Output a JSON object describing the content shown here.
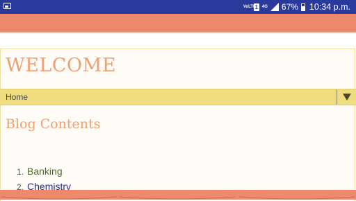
{
  "status_bar": {
    "volte": "VoLTE",
    "sim": "1",
    "network": "4G",
    "battery_percent": "67%",
    "battery_level": 0.67,
    "time": "10:34 p.m."
  },
  "page": {
    "welcome": "WELCOME",
    "nav": {
      "selected": "Home"
    },
    "blog_title": "Blog Contents",
    "list": [
      {
        "number": "1.",
        "label": "Banking"
      },
      {
        "number": "2.",
        "label": "Chemistry"
      }
    ]
  },
  "colors": {
    "status_bar": "#2a3a9c",
    "header": "#ec8a6b",
    "nav_bar": "#efdc7f",
    "heading": "#f0a070"
  },
  "icons": [
    "app-icon",
    "sim-icon",
    "signal-icon",
    "battery-icon",
    "dropdown-arrow-icon"
  ]
}
